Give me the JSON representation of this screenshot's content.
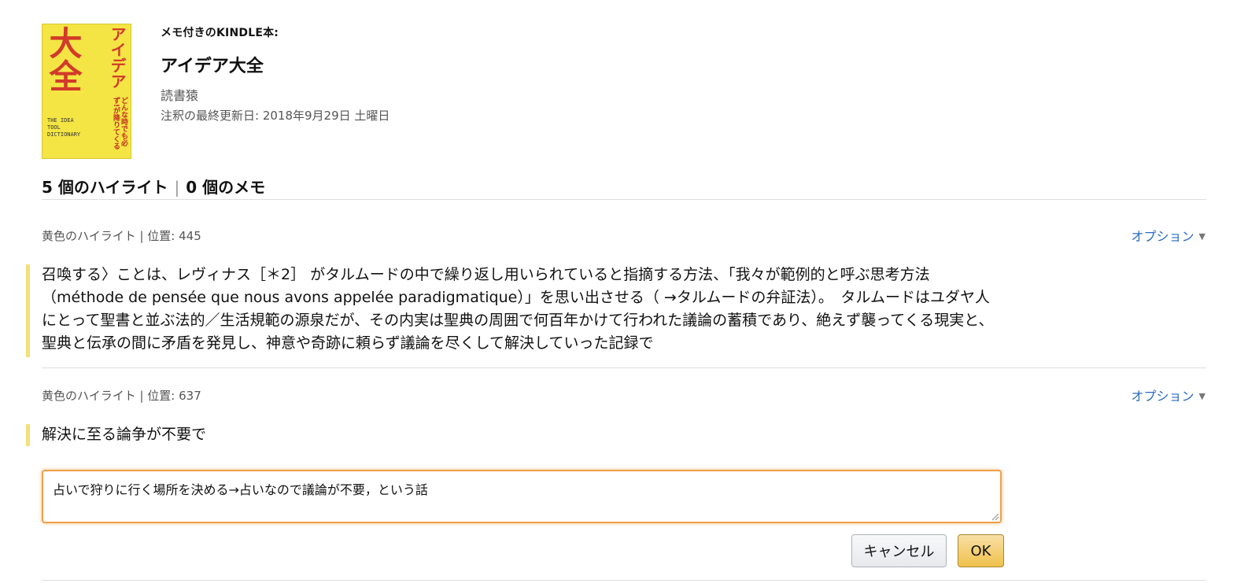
{
  "book": {
    "section_label": "メモ付きのKINDLE本:",
    "title": "アイデア大全",
    "author": "読書猿",
    "last_updated": "注釈の最終更新日:  2018年9月29日 土曜日",
    "cover": {
      "big_text": "大全",
      "vertical_title": "アイデア",
      "english_title": "THE IDEA TOOL DICTIONARY",
      "tagline": "どんな時でも必ず!が降りてくる"
    }
  },
  "counts": {
    "highlights": "5 個のハイライト",
    "separator": "|",
    "notes": "0 個のメモ"
  },
  "annotations": [
    {
      "meta": "黄色のハイライト | 位置: 445",
      "options_label": "オプション",
      "text": "召喚する〉ことは、レヴィナス［＊2］ がタルムードの中で繰り返し用いられていると指摘する方法、「我々が範例的と呼ぶ思考方法（méthode de pensée que nous avons appelée paradigmatique）」を思い出させる（ →タルムードの弁証法）。　タルムードはユダヤ人にとって聖書と並ぶ法的／生活規範の源泉だが、その内実は聖典の周囲で何百年かけて行われた議論の蓄積であり、絶えず襲ってくる現実と、聖典と伝承の間に矛盾を発見し、神意や奇跡に頼らず議論を尽くして解決していった記録で"
    },
    {
      "meta": "黄色のハイライト | 位置: 637",
      "options_label": "オプション",
      "text": "解決に至る論争が不要で"
    }
  ],
  "note_editor": {
    "value": "占いで狩りに行く場所を決める→占いなので議論が不要，という話",
    "cancel_label": "キャンセル",
    "ok_label": "OK"
  },
  "colors": {
    "highlight_yellow": "#f3e07a",
    "link_blue": "#2a6bbf",
    "focus_orange": "#f0a04b",
    "ok_button": "#f0c14b"
  }
}
